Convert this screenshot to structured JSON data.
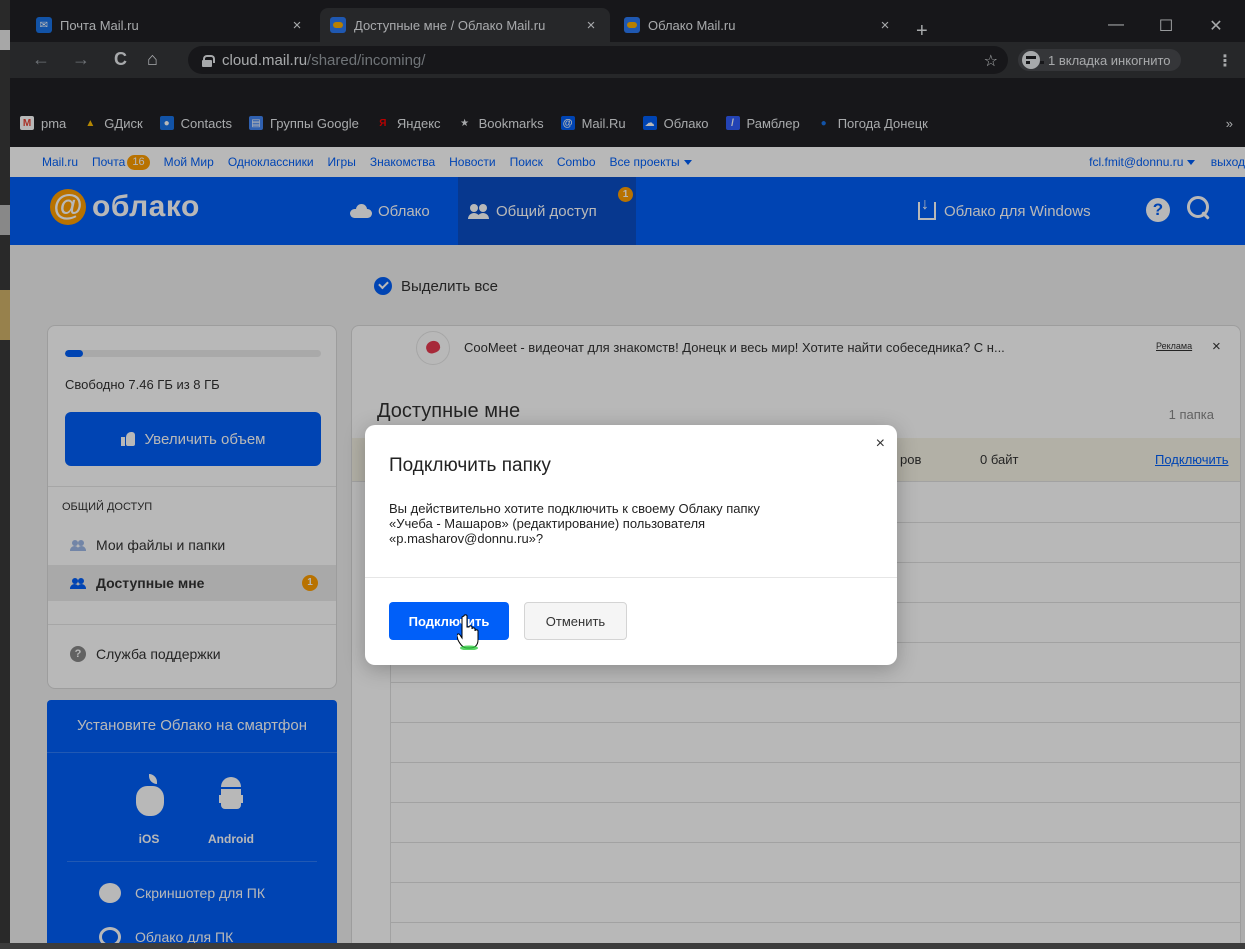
{
  "browser": {
    "tabs": [
      {
        "title": "Почта Mail.ru",
        "active": false
      },
      {
        "title": "Доступные мне / Облако Mail.ru",
        "active": true
      },
      {
        "title": "Облако Mail.ru",
        "active": false
      }
    ],
    "new_tab": "+",
    "window_controls": [
      "minimize",
      "maximize",
      "close"
    ],
    "url_host": "cloud.mail.ru",
    "url_path": "/shared/incoming/",
    "incognito_label": "1 вкладка инкогнито",
    "bookmarks": [
      {
        "label": "pma",
        "icon": "gmail-icon",
        "color": "#ea4335"
      },
      {
        "label": "GДиск",
        "icon": "google-drive-icon",
        "color": "#fbbc04"
      },
      {
        "label": "Contacts",
        "icon": "contacts-icon",
        "color": "#1a73e8"
      },
      {
        "label": "Группы Google",
        "icon": "groups-icon",
        "color": "#4285f4"
      },
      {
        "label": "Яндекс",
        "icon": "yandex-icon",
        "color": "#ff0000"
      },
      {
        "label": "Bookmarks",
        "icon": "star-icon",
        "color": "#e8eaed"
      },
      {
        "label": "Mail.Ru",
        "icon": "mailru-icon",
        "color": "#005ff9"
      },
      {
        "label": "Облако",
        "icon": "cloud-icon",
        "color": "#005ff9"
      },
      {
        "label": "Рамблер",
        "icon": "rambler-icon",
        "color": "#315efb"
      },
      {
        "label": "Погода Донецк",
        "icon": "weather-icon",
        "color": "#1a73e8"
      }
    ],
    "bookmarks_more": "»"
  },
  "portal": {
    "links": [
      "Mail.ru",
      "Почта",
      "Мой Мир",
      "Одноклассники",
      "Игры",
      "Знакомства",
      "Новости",
      "Поиск",
      "Combo",
      "Все проекты"
    ],
    "mail_badge": "16",
    "user": "fcl.fmit@donnu.ru",
    "logout": "выход"
  },
  "header": {
    "logo_at": "@",
    "logo_word": "облако",
    "nav_cloud": "Облако",
    "nav_shared": "Общий доступ",
    "shared_badge": "1",
    "windows_app": "Облако для Windows",
    "help": "?"
  },
  "select_all": "Выделить все",
  "sidebar": {
    "quota_used_fraction": 0.07,
    "quota_text": "Свободно 7.46 ГБ из 8 ГБ",
    "upgrade_button": "Увеличить объем",
    "section_title": "ОБЩИЙ ДОСТУП",
    "items": [
      {
        "label": "Мои файлы и папки",
        "active": false
      },
      {
        "label": "Доступные мне",
        "active": true,
        "badge": "1"
      }
    ],
    "support": "Служба поддержки"
  },
  "promo": {
    "title": "Установите Облако на смартфон",
    "ios": "iOS",
    "android": "Android",
    "screenshoter": "Скриншотер для ПК",
    "desktop": "Облако для ПК"
  },
  "main": {
    "ad_text": "CooMeet - видеочат для знакомств!   Донецк и весь мир! Хотите найти собеседника? С н...",
    "ad_label": "Реклама",
    "ad_close": "×",
    "title": "Доступные мне",
    "folder_count": "1 папка",
    "row": {
      "name_tail": "ров",
      "size": "0 байт",
      "action": "Подключить"
    }
  },
  "modal": {
    "title": "Подключить папку",
    "close": "×",
    "body_line1": "Вы действительно хотите подключить к своему Облаку папку",
    "body_line2": "«Учеба - Машаров» (редактирование) пользователя",
    "body_line3": "«p.masharov@donnu.ru»?",
    "confirm": "Подключить",
    "cancel": "Отменить"
  }
}
